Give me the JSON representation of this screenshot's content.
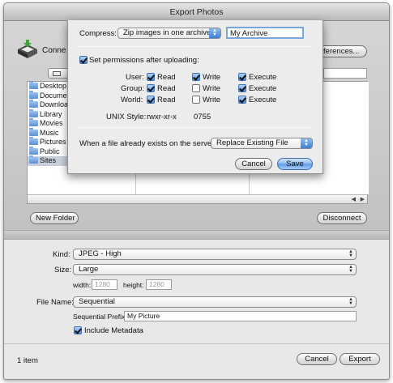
{
  "window": {
    "title": "Export Photos"
  },
  "browser": {
    "connect_label": "Conne",
    "preferences_button": "references...",
    "folders": [
      "Desktop",
      "Documents",
      "Downloads",
      "Library",
      "Movies",
      "Music",
      "Pictures",
      "Public",
      "Sites"
    ],
    "selected_folder": "Sites",
    "new_folder_button": "New Folder",
    "disconnect_button": "Disconnect"
  },
  "options": {
    "kind_label": "Kind:",
    "kind_value": "JPEG - High",
    "size_label": "Size:",
    "size_value": "Large",
    "width_label": "width:",
    "width_value": "1280",
    "height_label": "height:",
    "height_value": "1280",
    "filename_label": "File Name:",
    "filename_value": "Sequential",
    "prefix_label": "Sequential Prefix:",
    "prefix_value": "My Picture",
    "include_metadata_label": "Include Metadata",
    "include_metadata_checked": true
  },
  "footer": {
    "item_count": "1 item",
    "cancel_button": "Cancel",
    "export_button": "Export"
  },
  "sheet": {
    "compress_label": "Compress:",
    "compress_value": "Zip images in one archive",
    "archive_name": "My Archive",
    "set_permissions_label": "Set permissions after uploading:",
    "rows": [
      {
        "who": "User:",
        "read": "Read",
        "write": "Write",
        "execute": "Execute",
        "r": true,
        "w": true,
        "x": true
      },
      {
        "who": "Group:",
        "read": "Read",
        "write": "Write",
        "execute": "Execute",
        "r": true,
        "w": false,
        "x": true
      },
      {
        "who": "World:",
        "read": "Read",
        "write": "Write",
        "execute": "Execute",
        "r": true,
        "w": false,
        "x": true
      }
    ],
    "unix_style_label": "UNIX Style:",
    "unix_style_value": "rwxr-xr-x",
    "octal_value": "0755",
    "exists_label": "When a file already exists on the server:",
    "exists_value": "Replace Existing File",
    "cancel_button": "Cancel",
    "save_button": "Save"
  }
}
